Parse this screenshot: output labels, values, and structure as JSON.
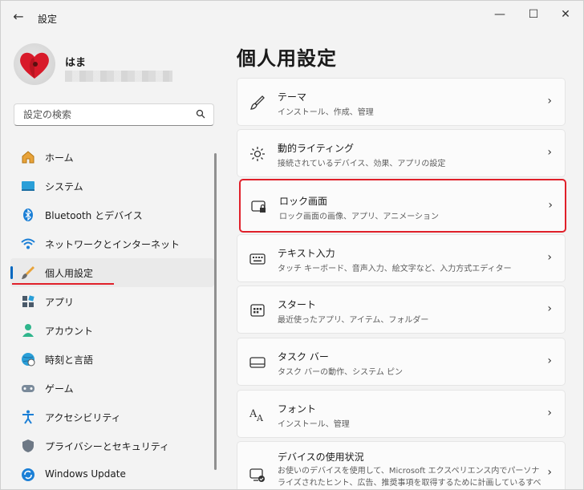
{
  "app": {
    "title": "設定"
  },
  "window_controls": {
    "minimize": "—",
    "maximize": "☐",
    "close": "✕"
  },
  "profile": {
    "name": "はま"
  },
  "search": {
    "placeholder": "設定の検索"
  },
  "nav": {
    "items": [
      {
        "label": "ホーム",
        "icon": "home-icon"
      },
      {
        "label": "システム",
        "icon": "system-icon"
      },
      {
        "label": "Bluetooth とデバイス",
        "icon": "bluetooth-icon"
      },
      {
        "label": "ネットワークとインターネット",
        "icon": "wifi-icon"
      },
      {
        "label": "個人用設定",
        "icon": "brush-icon",
        "active": true
      },
      {
        "label": "アプリ",
        "icon": "apps-icon"
      },
      {
        "label": "アカウント",
        "icon": "account-icon"
      },
      {
        "label": "時刻と言語",
        "icon": "globe-clock-icon"
      },
      {
        "label": "ゲーム",
        "icon": "gamepad-icon"
      },
      {
        "label": "アクセシビリティ",
        "icon": "accessibility-icon"
      },
      {
        "label": "プライバシーとセキュリティ",
        "icon": "shield-icon"
      },
      {
        "label": "Windows Update",
        "icon": "update-icon"
      }
    ]
  },
  "main": {
    "title": "個人用設定",
    "cards": [
      {
        "title": "テーマ",
        "desc": "インストール、作成、管理",
        "icon": "brush-icon"
      },
      {
        "title": "動的ライティング",
        "desc": "接続されているデバイス、効果、アプリの設定",
        "icon": "lighting-icon"
      },
      {
        "title": "ロック画面",
        "desc": "ロック画面の画像、アプリ、アニメーション",
        "icon": "lock-screen-icon",
        "highlighted": true
      },
      {
        "title": "テキスト入力",
        "desc": "タッチ キーボード、音声入力、絵文字など、入力方式エディター",
        "icon": "keyboard-icon"
      },
      {
        "title": "スタート",
        "desc": "最近使ったアプリ、アイテム、フォルダー",
        "icon": "start-icon"
      },
      {
        "title": "タスク バー",
        "desc": "タスク バーの動作、システム ピン",
        "icon": "taskbar-icon"
      },
      {
        "title": "フォント",
        "desc": "インストール、管理",
        "icon": "font-icon"
      },
      {
        "title": "デバイスの使用状況",
        "desc": "お使いのデバイスを使用して、Microsoft エクスペリエンス内でパーソナライズされたヒント、広告、推奨事項を取得するために計画しているすべての方法",
        "icon": "device-usage-icon"
      }
    ]
  },
  "colors": {
    "accent": "#0067c0",
    "highlight": "#e0202a"
  }
}
